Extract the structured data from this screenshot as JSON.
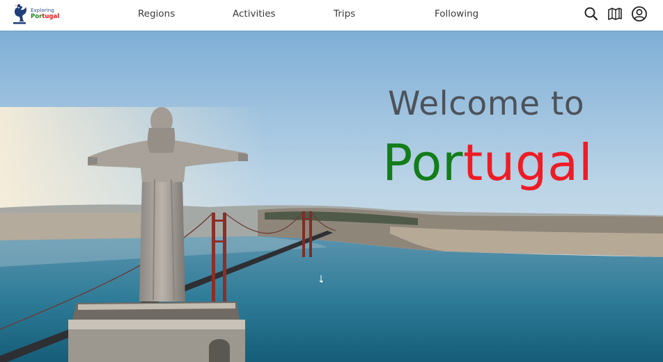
{
  "logo": {
    "line1": "Exploring",
    "line2_green": "Por",
    "line2_red": "tugal",
    "icon": "rooster-icon"
  },
  "nav": {
    "items": [
      {
        "label": "Regions"
      },
      {
        "label": "Activities"
      },
      {
        "label": "Trips"
      },
      {
        "label": "Following"
      }
    ]
  },
  "actions": {
    "search_icon": "search-icon",
    "map_icon": "map-icon",
    "account_icon": "account-icon"
  },
  "hero": {
    "welcome": "Welcome to",
    "title_green": "Por",
    "title_red": "tugal"
  },
  "colors": {
    "green": "#137d1a",
    "red": "#ee1c25",
    "welcome_gray": "#4c525a",
    "nav_text": "#3a3a3a"
  }
}
